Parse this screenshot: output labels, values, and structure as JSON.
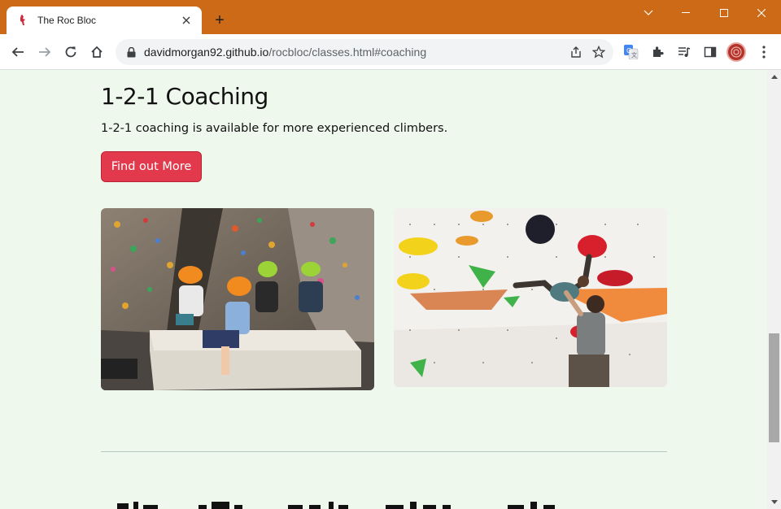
{
  "browser": {
    "tab": {
      "title": "The Roc Bloc",
      "favicon": "climber-favicon"
    },
    "new_tab_label": "+",
    "window_controls": [
      "tab-search-icon",
      "minimize-icon",
      "maximize-icon",
      "close-icon"
    ],
    "toolbar": {
      "url_host": "davidmorgan92.github.io",
      "url_path": "/rocbloc/classes.html#coaching",
      "icons": [
        "back-icon",
        "forward-icon",
        "reload-icon",
        "home-icon",
        "lock-icon",
        "share-icon",
        "star-icon",
        "translate-icon",
        "extensions-icon",
        "media-icon",
        "side-panel-icon",
        "avatar",
        "menu-icon"
      ]
    },
    "accent_color": "#cd6a17"
  },
  "page": {
    "heading": "1-2-1 Coaching",
    "subtext": "1-2-1 coaching is available for more experienced climbers.",
    "cta_label": "Find out More",
    "cta_color": "#e23a4c",
    "background_color": "#eef8ec",
    "images": [
      {
        "subject": "children in climbing helmets sitting on a crash mat in a bouldering gym"
      },
      {
        "subject": "climber on a bouldering wall with a coach spotting"
      }
    ]
  }
}
